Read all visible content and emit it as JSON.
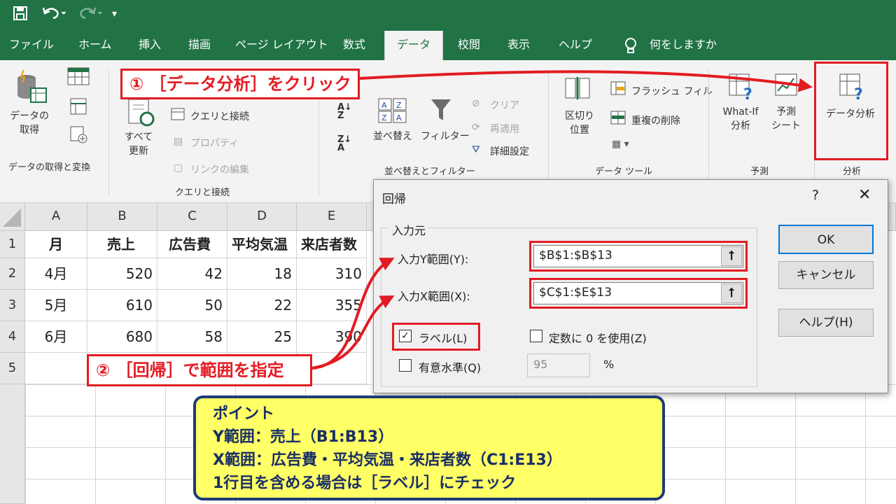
{
  "quick_access": {
    "save_icon": "save-icon",
    "undo_icon": "undo-icon",
    "redo_icon": "redo-icon"
  },
  "tabs": [
    "ファイル",
    "ホーム",
    "挿入",
    "描画",
    "ページ レイアウト",
    "数式",
    "データ",
    "校閲",
    "表示",
    "ヘルプ"
  ],
  "tell_me": "何をしますか",
  "ribbon": {
    "get_data": "データの\n取得",
    "group_get": "データの取得と変換",
    "refresh_all": "すべて\n更新",
    "queries": "クエリと接続",
    "properties": "プロパティ",
    "edit_links": "リンクの編集",
    "group_queries": "クエリと接続",
    "sort": "並べ替え",
    "filter": "フィルター",
    "clear": "クリア",
    "reapply": "再適用",
    "advanced": "詳細設定",
    "group_sort": "並べ替えとフィルター",
    "text_to_columns": "区切り\n位置",
    "flash_fill": "フラッシュ フィル",
    "remove_dup": "重複の削除",
    "group_tools": "データ ツール",
    "whatif": "What-If\n分析",
    "forecast": "予測\nシート",
    "group_forecast": "予測",
    "data_analysis": "データ分析",
    "group_analysis": "分析"
  },
  "sheet": {
    "columns": [
      "A",
      "B",
      "C",
      "D",
      "E"
    ],
    "rows": [
      "1",
      "2",
      "3",
      "4",
      "5"
    ],
    "cells": [
      [
        "月",
        "売上",
        "広告費",
        "平均気温",
        "来店者数"
      ],
      [
        "4月",
        "520",
        "42",
        "18",
        "310"
      ],
      [
        "5月",
        "610",
        "50",
        "22",
        "355"
      ],
      [
        "6月",
        "680",
        "58",
        "25",
        "390"
      ]
    ]
  },
  "dialog": {
    "title": "回帰",
    "help_q": "?",
    "close": "✕",
    "group": "入力元",
    "y_label": "入力Y範囲(Y):",
    "y_value": "$B$1:$B$13",
    "x_label": "入力X範囲(X):",
    "x_value": "$C$1:$E$13",
    "labels": "ラベル(L)",
    "const_zero": "定数に 0 を使用(Z)",
    "confidence": "有意水準(Q)",
    "confidence_value": "95",
    "percent": "%",
    "ok": "OK",
    "cancel": "キャンセル",
    "help": "ヘルプ(H)"
  },
  "callouts": {
    "step1": "① ［データ分析］をクリック",
    "step2": "② ［回帰］で範囲を指定"
  },
  "point": {
    "title": "ポイント",
    "line1": "Y範囲：売上（B1:B13）",
    "line2": "X範囲：広告費・平均気温・来店者数（C1:E13）",
    "line3": "1行目を含める場合は［ラベル］にチェック"
  },
  "colors": {
    "excel_green": "#217346",
    "accent_red": "#e31b23",
    "note_yellow": "#ffff66",
    "note_navy": "#1f3a77"
  }
}
